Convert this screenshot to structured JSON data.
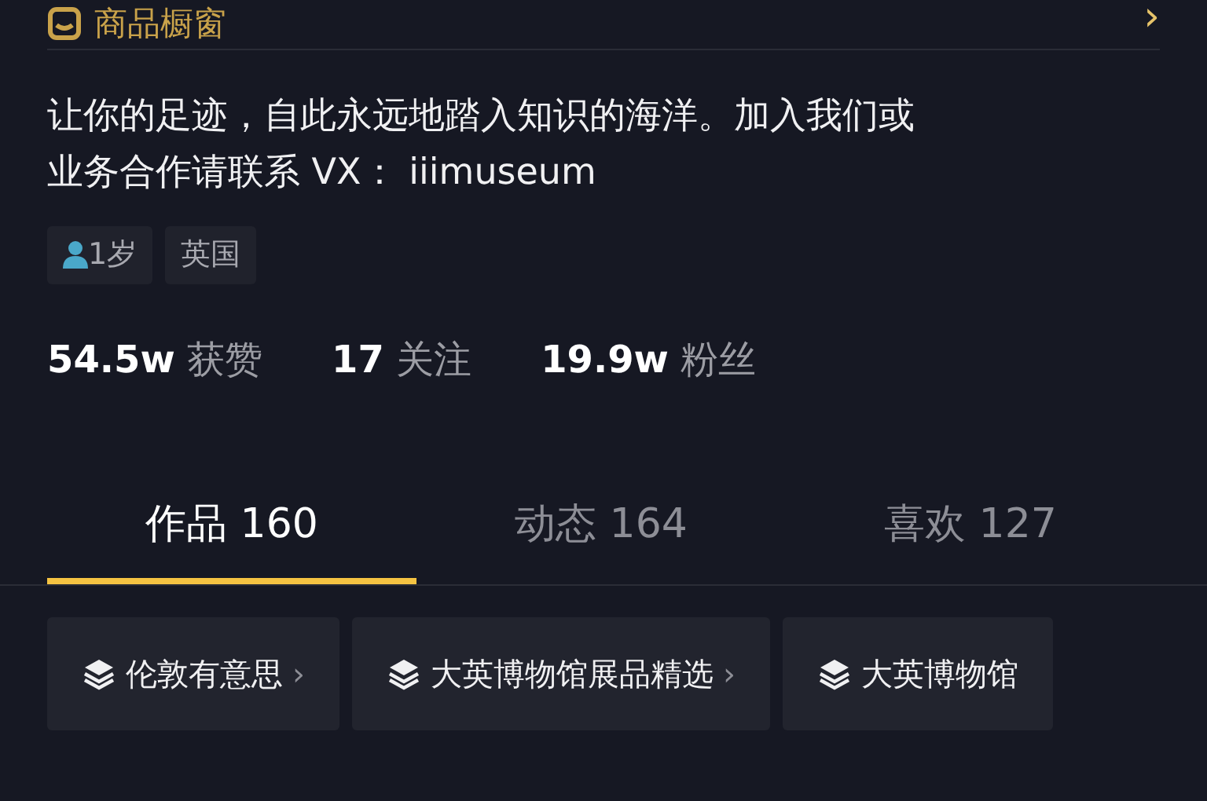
{
  "shop_row": {
    "label": "商品橱窗",
    "chevron": "›"
  },
  "bio": "让你的足迹，自此永远地踏入知识的海洋。加入我们或业务合作请联系 VX： iiimuseum",
  "tags": [
    {
      "kind": "age",
      "label": "1岁"
    },
    {
      "kind": "plain",
      "label": "英国"
    }
  ],
  "stats": [
    "**54.5w** 获赞",
    "**17** 关注",
    "**19.9w** 粉丝"
  ],
  "tabs": [
    {
      "label": "作品 160",
      "selected": true
    },
    {
      "label": "动态 164",
      "selected": false
    },
    {
      "label": "喜欢 127",
      "selected": false
    }
  ],
  "collections": [
    {
      "label": "伦敦有意思",
      "chevron": "›"
    },
    {
      "label": "大英博物馆展品精选",
      "chevron": "›"
    },
    {
      "label": "大英博物馆"
    }
  ]
}
